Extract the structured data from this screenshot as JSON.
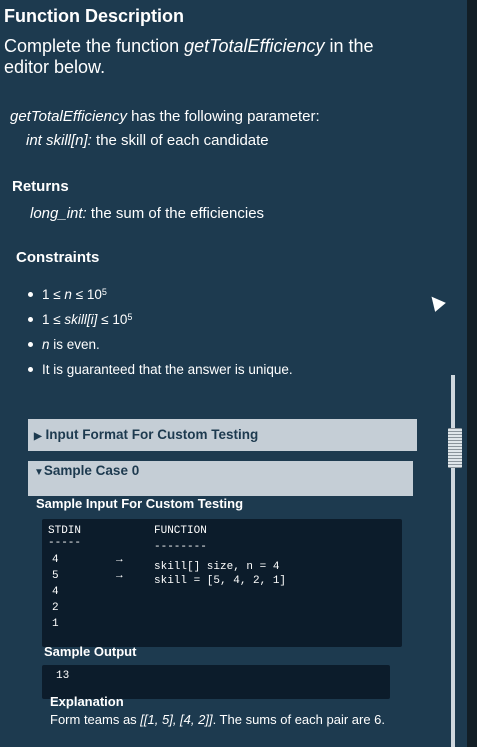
{
  "function_description": {
    "heading": "Function Description",
    "intro_prefix": "Complete the function ",
    "function_name": "getTotalEfficiency",
    "intro_suffix": " in the editor below."
  },
  "parameters": {
    "function_name": "getTotalEfficiency",
    "text": " has the following parameter:",
    "param_type": "int skill[n]:",
    "param_desc": " the skill of each candidate"
  },
  "returns": {
    "heading": "Returns",
    "type": "long_int:",
    "desc": " the sum of the efficiencies"
  },
  "constraints": {
    "heading": "Constraints",
    "items": [
      {
        "pre": "1 ≤ ",
        "var": "n",
        "post": " ≤ 10",
        "sup": "5"
      },
      {
        "pre": "1 ≤ ",
        "var": "skill[i]",
        "post": " ≤ 10",
        "sup": "5"
      },
      {
        "pre": "",
        "var": "n",
        "post": " is even.",
        "sup": ""
      },
      {
        "pre": "It is guaranteed that the answer is unique.",
        "var": "",
        "post": "",
        "sup": ""
      }
    ]
  },
  "sections": {
    "input_format": {
      "arrow": "▶",
      "label": "Input Format For Custom Testing"
    },
    "sample_case": {
      "arrow": "▼",
      "label": "Sample Case 0"
    }
  },
  "sample": {
    "input_heading": "Sample Input For Custom Testing",
    "stdin_header": "STDIN",
    "stdin_rule": "-----",
    "function_header": "FUNCTION",
    "function_rule": "--------",
    "stdin_values": [
      "4",
      "5",
      "4",
      "2",
      "1"
    ],
    "arrow": "→",
    "function_lines": [
      "skill[] size, n = 4",
      "skill = [5, 4, 2, 1]"
    ],
    "output_heading": "Sample Output",
    "output_value": "13",
    "explanation_heading": "Explanation",
    "explanation_prefix": "Form teams as ",
    "explanation_teams": "[[1, 5], [4, 2]]",
    "explanation_suffix": ". The sums of each pair are 6."
  },
  "colors": {
    "background": "#1d3a4f",
    "code_bg": "#0c1c2b",
    "bar_bg": "#c5ced6"
  }
}
